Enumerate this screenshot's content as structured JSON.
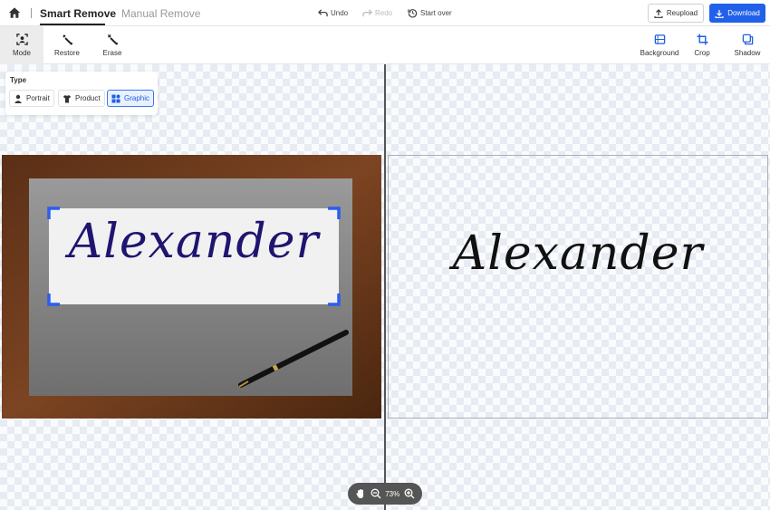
{
  "header": {
    "tabs": [
      {
        "label": "Smart Remove",
        "active": true
      },
      {
        "label": "Manual Remove",
        "active": false
      }
    ],
    "undo_label": "Undo",
    "redo_label": "Redo",
    "start_over_label": "Start over",
    "reupload_label": "Reupload",
    "download_label": "Download",
    "accent_color": "#2160e9"
  },
  "toolbar": {
    "left_tools": [
      {
        "label": "Mode",
        "icon": "mode-icon",
        "active": true
      },
      {
        "label": "Restore",
        "icon": "restore-icon",
        "active": false
      },
      {
        "label": "Erase",
        "icon": "erase-icon",
        "active": false
      }
    ],
    "right_tools": [
      {
        "label": "Background",
        "icon": "background-icon"
      },
      {
        "label": "Crop",
        "icon": "crop-icon"
      },
      {
        "label": "Shadow",
        "icon": "shadow-icon"
      }
    ]
  },
  "type_panel": {
    "title": "Type",
    "options": [
      {
        "label": "Portrait",
        "icon": "person-icon",
        "active": false
      },
      {
        "label": "Product",
        "icon": "tshirt-icon",
        "active": false
      },
      {
        "label": "Graphic",
        "icon": "graphic-icon",
        "active": true
      }
    ]
  },
  "image": {
    "signature_text": "Alexander",
    "ink_color_original": "#1f1470",
    "ink_color_result": "#111111"
  },
  "zoom": {
    "level": "73%"
  }
}
